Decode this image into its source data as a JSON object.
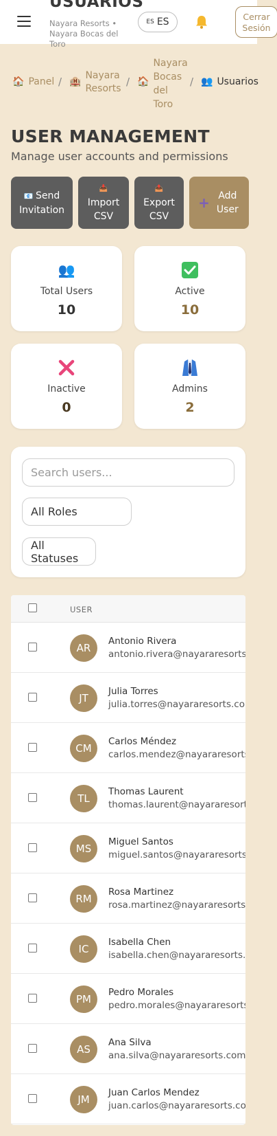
{
  "header": {
    "title": "USUARIOS",
    "subtitle": "Nayara Resorts • Nayara Bocas del Toro",
    "lang_flag": "ES",
    "lang_code": "ES",
    "logout_label": "Cerrar Sesión"
  },
  "breadcrumb": {
    "items": [
      "Panel",
      "Nayara Resorts",
      "Nayara Bocas del Toro",
      "Usuarios"
    ],
    "separator": "/"
  },
  "page": {
    "title": "USER MANAGEMENT",
    "subtitle": "Manage user accounts and permissions"
  },
  "actions": {
    "send_invitation": "Send Invitation",
    "import_csv": "Import CSV",
    "export_csv": "Export CSV",
    "add_user": "Add User"
  },
  "stats": {
    "total": {
      "label": "Total Users",
      "value": "10"
    },
    "active": {
      "label": "Active",
      "value": "10"
    },
    "inactive": {
      "label": "Inactive",
      "value": "0"
    },
    "admins": {
      "label": "Admins",
      "value": "2"
    }
  },
  "filters": {
    "search_placeholder": "Search users...",
    "search_value": "",
    "role_selected": "All Roles",
    "status_selected": "All Statuses"
  },
  "table": {
    "column_user": "USER",
    "rows": [
      {
        "initials": "AR",
        "name": "Antonio Rivera",
        "email": "antonio.rivera@nayararesorts.com"
      },
      {
        "initials": "JT",
        "name": "Julia Torres",
        "email": "julia.torres@nayararesorts.com"
      },
      {
        "initials": "CM",
        "name": "Carlos Méndez",
        "email": "carlos.mendez@nayararesorts.com"
      },
      {
        "initials": "TL",
        "name": "Thomas Laurent",
        "email": "thomas.laurent@nayararesorts.com"
      },
      {
        "initials": "MS",
        "name": "Miguel Santos",
        "email": "miguel.santos@nayararesorts.com"
      },
      {
        "initials": "RM",
        "name": "Rosa Martinez",
        "email": "rosa.martinez@nayararesorts.com"
      },
      {
        "initials": "IC",
        "name": "Isabella Chen",
        "email": "isabella.chen@nayararesorts.com"
      },
      {
        "initials": "PM",
        "name": "Pedro Morales",
        "email": "pedro.morales@nayararesorts.com"
      },
      {
        "initials": "AS",
        "name": "Ana Silva",
        "email": "ana.silva@nayararesorts.com"
      },
      {
        "initials": "JM",
        "name": "Juan Carlos Mendez",
        "email": "juan.carlos@nayararesorts.com"
      }
    ]
  },
  "colors": {
    "background": "#f3e7d2",
    "brand": "#a98e63",
    "dark_button": "#5d5d5d",
    "stat_total": "#333333",
    "stat_active": "#8a6d3b",
    "stat_inactive": "#4a3a22",
    "stat_admins": "#8a6d3b"
  },
  "icons": {
    "menu": "hamburger-icon",
    "bell": "bell-icon",
    "panel": "house-icon",
    "resorts": "hotel-icon",
    "property": "house-icon",
    "users": "users-icon",
    "send": "envelope-icon",
    "import": "inbox-icon",
    "export": "outbox-icon",
    "add": "plus-icon",
    "total": "users-icon",
    "active": "check-icon",
    "inactive": "x-icon",
    "admins": "suit-icon"
  }
}
